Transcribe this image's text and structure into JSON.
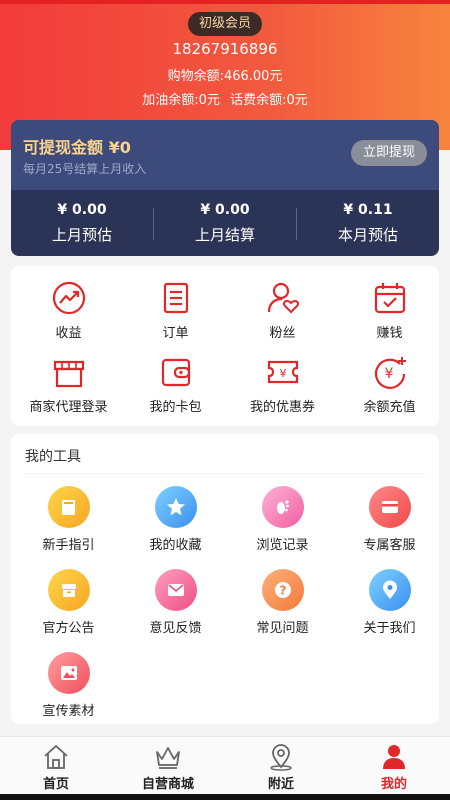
{
  "header": {
    "level_badge": "初级会员",
    "phone": "18267916896",
    "shopping_balance": "购物余额:466.00元",
    "other_balance": "加油余额:0元 话费余额:0元"
  },
  "wallet": {
    "title": "可提现金额 ¥0",
    "subtitle": "每月25号结算上月收入",
    "withdraw_label": "立即提现",
    "stats": [
      {
        "value": "¥ 0.00",
        "label": "上月预估"
      },
      {
        "value": "¥ 0.00",
        "label": "上月结算"
      },
      {
        "value": "¥ 0.11",
        "label": "本月预估"
      }
    ]
  },
  "menu": {
    "items": [
      {
        "label": "收益",
        "icon": "earnings-chart-icon"
      },
      {
        "label": "订单",
        "icon": "order-list-icon"
      },
      {
        "label": "粉丝",
        "icon": "fans-heart-icon"
      },
      {
        "label": "赚钱",
        "icon": "calendar-check-icon"
      },
      {
        "label": "商家代理登录",
        "icon": "store-icon"
      },
      {
        "label": "我的卡包",
        "icon": "wallet-icon"
      },
      {
        "label": "我的优惠券",
        "icon": "coupon-icon"
      },
      {
        "label": "余额充值",
        "icon": "yuan-recharge-icon"
      }
    ]
  },
  "tools": {
    "title": "我的工具",
    "items": [
      {
        "label": "新手指引",
        "icon": "book-icon"
      },
      {
        "label": "我的收藏",
        "icon": "star-icon"
      },
      {
        "label": "浏览记录",
        "icon": "footprint-icon"
      },
      {
        "label": "专属客服",
        "icon": "card-service-icon"
      },
      {
        "label": "官方公告",
        "icon": "announcement-box-icon"
      },
      {
        "label": "意见反馈",
        "icon": "mail-icon"
      },
      {
        "label": "常见问题",
        "icon": "question-icon"
      },
      {
        "label": "关于我们",
        "icon": "location-pin-icon"
      },
      {
        "label": "宣传素材",
        "icon": "image-icon"
      }
    ]
  },
  "tabbar": {
    "items": [
      {
        "label": "首页",
        "icon": "home-icon"
      },
      {
        "label": "自营商城",
        "icon": "crown-icon"
      },
      {
        "label": "附近",
        "icon": "map-pin-icon"
      },
      {
        "label": "我的",
        "icon": "user-icon"
      }
    ],
    "active_color": "#e0282b"
  },
  "colors": {
    "brand_red": "#e0282b",
    "wallet_gold": "#f6d48d"
  }
}
